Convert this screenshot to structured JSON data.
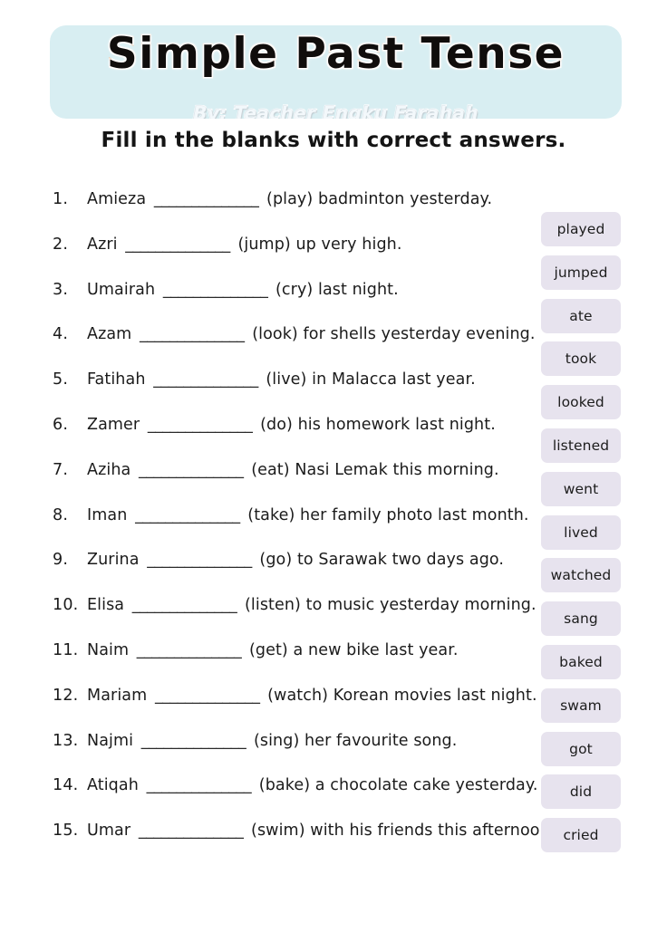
{
  "page": {
    "background_color": "#ffffff",
    "banner_color": "#d8eef2",
    "chip_color": "#e7e3ee",
    "title_outline_color": "#f6cbaa"
  },
  "header": {
    "title": "Simple Past Tense",
    "subtitle": "By: Teacher Engku Farahah"
  },
  "instruction": "Fill in the blanks with correct answers.",
  "blank": "______________",
  "questions": [
    {
      "num": "1.",
      "before": "Amieza",
      "after": "(play) badminton yesterday."
    },
    {
      "num": "2.",
      "before": "Azri",
      "after": "(jump) up very high."
    },
    {
      "num": "3.",
      "before": "Umairah",
      "after": "(cry) last night."
    },
    {
      "num": "4.",
      "before": "Azam",
      "after": "(look) for shells yesterday evening."
    },
    {
      "num": "5.",
      "before": "Fatihah",
      "after": "(live) in Malacca last year."
    },
    {
      "num": "6.",
      "before": "Zamer",
      "after": "(do) his homework last night."
    },
    {
      "num": "7.",
      "before": "Aziha",
      "after": "(eat) Nasi Lemak this morning."
    },
    {
      "num": "8.",
      "before": "Iman",
      "after": "(take) her family photo last month."
    },
    {
      "num": "9.",
      "before": "Zurina",
      "after": "(go) to Sarawak two days ago."
    },
    {
      "num": "10.",
      "before": "Elisa",
      "after": "(listen) to music yesterday morning."
    },
    {
      "num": "11.",
      "before": "Naim",
      "after": "(get) a new bike last year."
    },
    {
      "num": "12.",
      "before": "Mariam",
      "after": "(watch) Korean movies last night."
    },
    {
      "num": "13.",
      "before": "Najmi",
      "after": "(sing) her favourite song."
    },
    {
      "num": "14.",
      "before": "Atiqah",
      "after": "(bake) a chocolate cake yesterday."
    },
    {
      "num": "15.",
      "before": "Umar",
      "after": "(swim) with his friends this afternoon."
    }
  ],
  "word_bank": [
    {
      "word": "played"
    },
    {
      "word": "jumped"
    },
    {
      "word": "ate"
    },
    {
      "word": "took"
    },
    {
      "word": "looked"
    },
    {
      "word": "listened"
    },
    {
      "word": "went"
    },
    {
      "word": "lived"
    },
    {
      "word": "watched"
    },
    {
      "word": "sang"
    },
    {
      "word": "baked"
    },
    {
      "word": "swam"
    },
    {
      "word": "got"
    },
    {
      "word": "did"
    },
    {
      "word": "cried"
    }
  ]
}
